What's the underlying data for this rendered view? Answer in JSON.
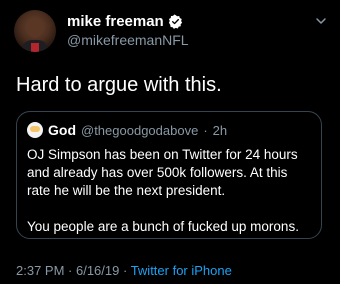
{
  "author": {
    "display_name": "mike freeman",
    "handle": "@mikefreemanNFL",
    "verified": true
  },
  "tweet_text": "Hard to argue with this.",
  "quoted_tweet": {
    "display_name": "God",
    "handle": "@thegoodgodabove",
    "separator": "·",
    "age": "2h",
    "paragraphs": [
      "OJ Simpson has been on Twitter for 24 hours and already has over 500k followers. At this rate he will be the next president.",
      "You people are a bunch of fucked up morons."
    ]
  },
  "meta": {
    "time": "2:37 PM",
    "separator_1": " · ",
    "date": "6/16/19",
    "separator_2": " · ",
    "source": "Twitter for iPhone"
  },
  "colors": {
    "background": "#000000",
    "secondary_text": "#8899a6",
    "link": "#1da1f2",
    "border": "#38444d"
  },
  "icons": {
    "verified": "verified-badge-icon",
    "menu": "chevron-down-icon"
  }
}
